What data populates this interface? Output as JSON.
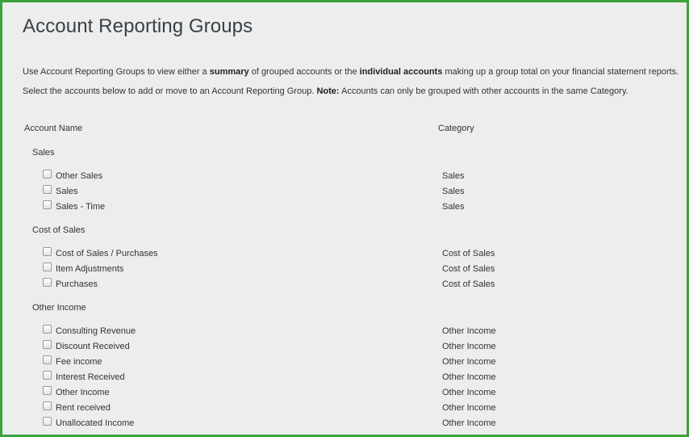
{
  "page": {
    "title": "Account Reporting Groups",
    "intro1": {
      "a": "Use Account Reporting Groups to view either a ",
      "b": "summary",
      "c": " of grouped accounts or the ",
      "d": "individual accounts",
      "e": " making up a group total on your financial statement reports."
    },
    "intro2": {
      "a": "Select the accounts below to add or move to an Account Reporting Group. ",
      "b": "Note:",
      "c": " Accounts can only be grouped with other accounts in the same Category."
    }
  },
  "table": {
    "col_account": "Account Name",
    "col_category": "Category"
  },
  "groups": [
    {
      "name": "Sales",
      "rows": [
        {
          "account": "Other Sales",
          "category": "Sales"
        },
        {
          "account": "Sales",
          "category": "Sales"
        },
        {
          "account": "Sales - Time",
          "category": "Sales"
        }
      ]
    },
    {
      "name": "Cost of Sales",
      "rows": [
        {
          "account": "Cost of Sales / Purchases",
          "category": "Cost of Sales"
        },
        {
          "account": "Item Adjustments",
          "category": "Cost of Sales"
        },
        {
          "account": "Purchases",
          "category": "Cost of Sales"
        }
      ]
    },
    {
      "name": "Other Income",
      "rows": [
        {
          "account": "Consulting Revenue",
          "category": "Other Income"
        },
        {
          "account": "Discount Received",
          "category": "Other Income"
        },
        {
          "account": "Fee income",
          "category": "Other Income"
        },
        {
          "account": "Interest Received",
          "category": "Other Income"
        },
        {
          "account": "Other Income",
          "category": "Other Income"
        },
        {
          "account": "Rent received",
          "category": "Other Income"
        },
        {
          "account": "Unallocated Income",
          "category": "Other Income"
        }
      ]
    }
  ],
  "colors": {
    "frame_border": "#3ca23c",
    "background": "#eceded",
    "title_text": "#3b3f45"
  }
}
